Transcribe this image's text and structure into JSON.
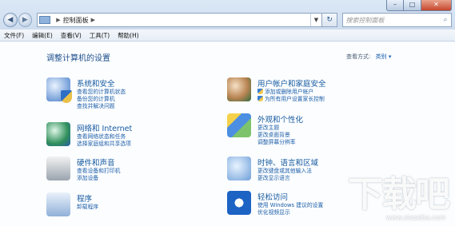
{
  "caption": {
    "minimize": "–",
    "maximize": "□",
    "close": "✕"
  },
  "address": {
    "back": "◀",
    "forward": "▶",
    "path": [
      "控制面板"
    ],
    "refresh": "↻",
    "search_placeholder": "搜索控制面板"
  },
  "menu": [
    "文件(F)",
    "编辑(E)",
    "查看(V)",
    "工具(T)",
    "帮助(H)"
  ],
  "main": {
    "heading": "调整计算机的设置",
    "view_by_label": "查看方式:",
    "view_by_value": "类别 ▾"
  },
  "categories_left": [
    {
      "icon": "system-security-icon",
      "title": "系统和安全",
      "links": [
        "查看您的计算机状态",
        "备份您的计算机",
        "查找并解决问题"
      ]
    },
    {
      "icon": "network-icon",
      "title": "网络和 Internet",
      "links": [
        "查看网络状态和任务",
        "选择家庭组和共享选项"
      ]
    },
    {
      "icon": "hardware-printer-icon",
      "title": "硬件和声音",
      "links": [
        "查看设备和打印机",
        "添加设备"
      ]
    },
    {
      "icon": "programs-icon",
      "title": "程序",
      "links": [
        "卸载程序"
      ]
    }
  ],
  "categories_right": [
    {
      "icon": "user-accounts-icon",
      "title": "用户帐户和家庭安全",
      "links": [
        "添加或删除用户帐户",
        "为所有用户设置家长控制"
      ]
    },
    {
      "icon": "appearance-icon",
      "title": "外观和个性化",
      "links": [
        "更改主题",
        "更改桌面背景",
        "调整屏幕分辨率"
      ]
    },
    {
      "icon": "clock-globe-icon",
      "title": "时钟、语言和区域",
      "links": [
        "更改键盘或其他输入法",
        "更改显示语言"
      ]
    },
    {
      "icon": "ease-of-access-icon",
      "title": "轻松访问",
      "links": [
        "使用 Windows 建议的设置",
        "优化视频显示"
      ]
    }
  ],
  "watermark": {
    "text": "下载吧",
    "url": "www.xiazaiba.com"
  }
}
